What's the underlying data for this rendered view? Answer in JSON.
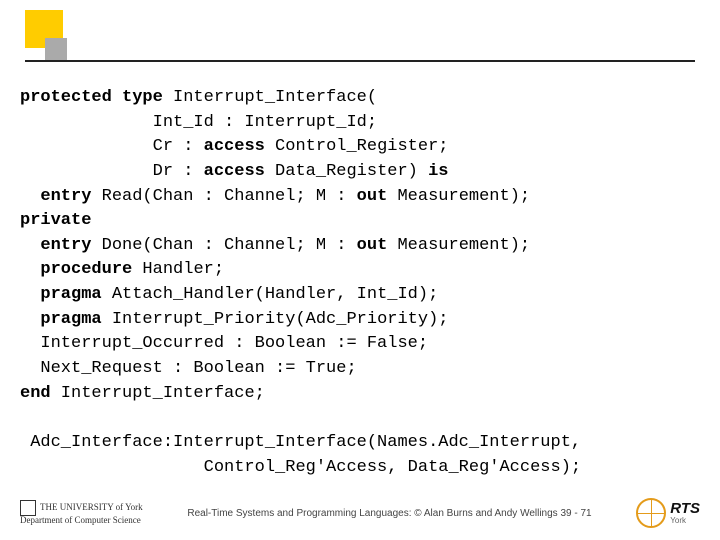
{
  "code": {
    "l1a": "protected type",
    "l1b": " Interrupt_Interface(",
    "l2": "             Int_Id : Interrupt_Id;",
    "l3a": "             Cr : ",
    "l3b": "access",
    "l3c": " Control_Register;",
    "l4a": "             Dr : ",
    "l4b": "access",
    "l4c": " Data_Register) ",
    "l4d": "is",
    "l5a": "  ",
    "l5b": "entry",
    "l5c": " Read(Chan : Channel; M : ",
    "l5d": "out",
    "l5e": " Measurement);",
    "l6": "private",
    "l7a": "  ",
    "l7b": "entry",
    "l7c": " Done(Chan : Channel; M : ",
    "l7d": "out",
    "l7e": " Measurement);",
    "l8a": "  ",
    "l8b": "procedure",
    "l8c": " Handler;",
    "l9a": "  ",
    "l9b": "pragma",
    "l9c": " Attach_Handler(Handler, Int_Id);",
    "l10a": "  ",
    "l10b": "pragma",
    "l10c": " Interrupt_Priority(Adc_Priority);",
    "l11": "  Interrupt_Occurred : Boolean := False;",
    "l12": "  Next_Request : Boolean := True;",
    "l13a": "end",
    "l13b": " Interrupt_Interface;",
    "l14": " Adc_Interface:Interrupt_Interface(Names.Adc_Interrupt,",
    "l15": "                  Control_Reg'Access, Data_Reg'Access);"
  },
  "footer": {
    "uni_line1": "THE UNIVERSITY of York",
    "uni_line2": "Department of Computer Science",
    "mid": "Real-Time Systems and Programming Languages: © Alan Burns and Andy Wellings  39 - 71",
    "rts": "RTS",
    "york": "York"
  }
}
